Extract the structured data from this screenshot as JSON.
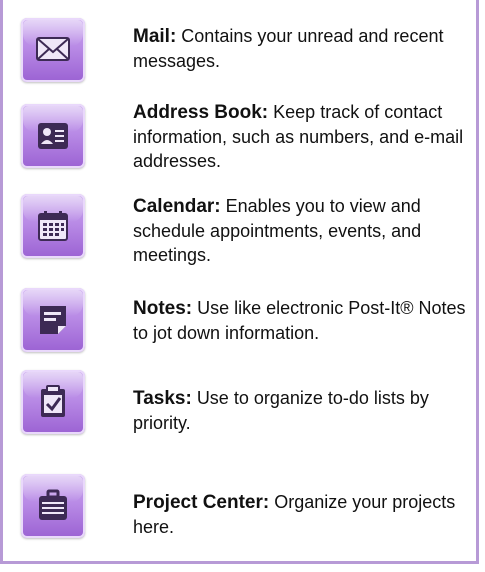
{
  "items": [
    {
      "icon": "mail-icon",
      "title": "Mail:",
      "desc": "Contains your unread and recent messages."
    },
    {
      "icon": "address-book-icon",
      "title": "Address Book:",
      "desc": "Keep track of contact information, such as numbers, and e-mail addresses."
    },
    {
      "icon": "calendar-icon",
      "title": "Calendar:",
      "desc": "Enables you to view and schedule appointments, events, and meetings."
    },
    {
      "icon": "notes-icon",
      "title": "Notes:",
      "desc": "Use like electronic Post-It® Notes to jot down information."
    },
    {
      "icon": "tasks-icon",
      "title": "Tasks:",
      "desc": "Use to organize to-do lists by priority."
    },
    {
      "icon": "project-center-icon",
      "title": "Project Center:",
      "desc": "Organize your projects here."
    }
  ],
  "colors": {
    "border": "#b79ad6",
    "icon_top": "#c9a6ee",
    "icon_bottom": "#9b62d3",
    "glyph": "#3d2a55"
  }
}
